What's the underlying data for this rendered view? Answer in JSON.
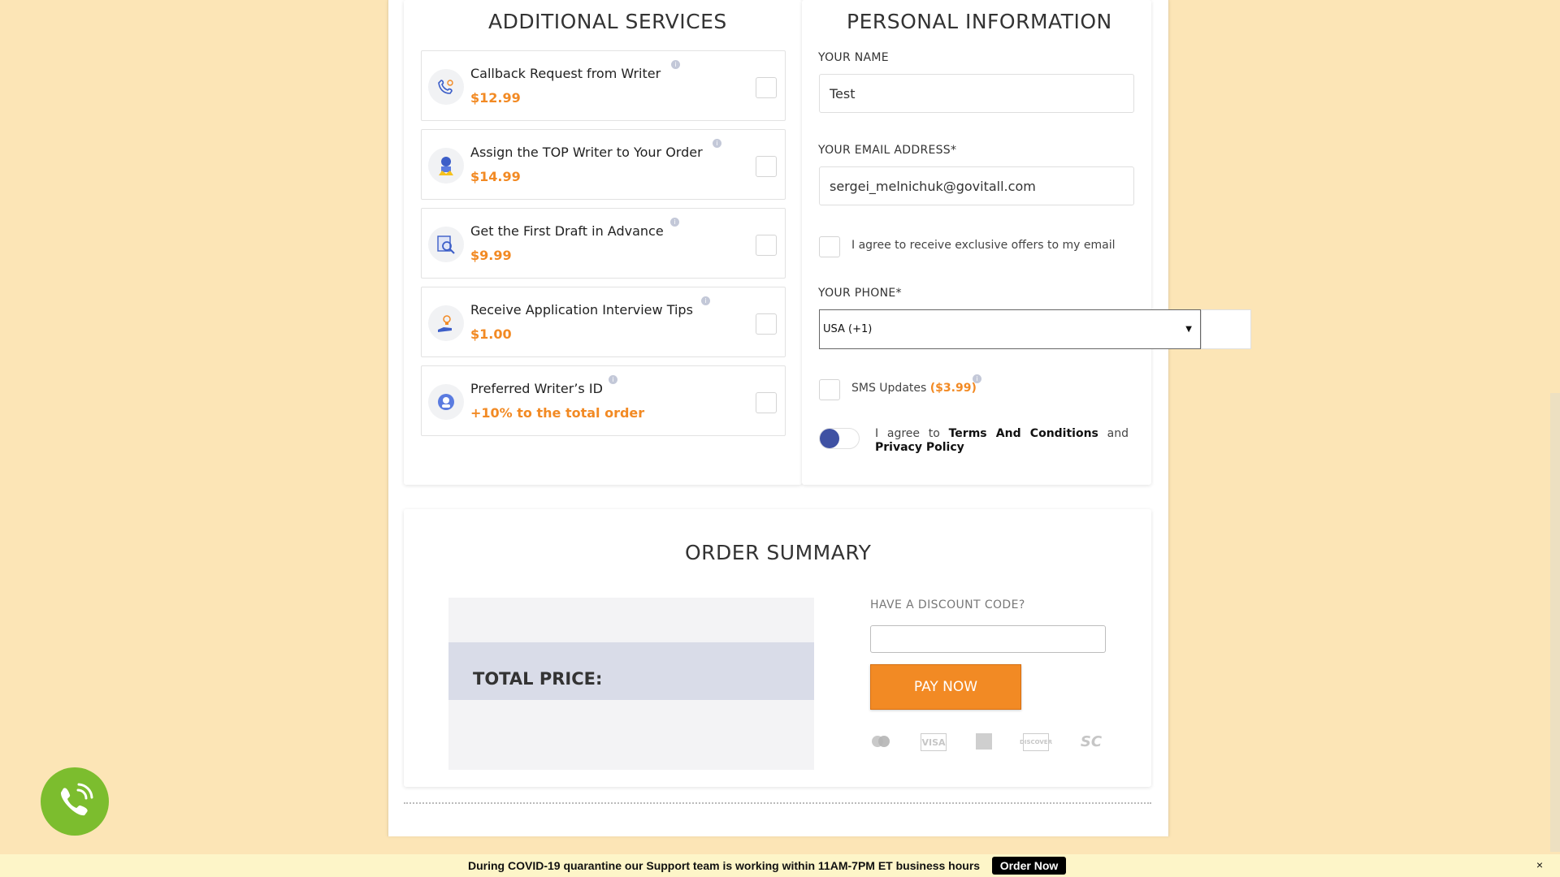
{
  "services": {
    "title": "ADDITIONAL SERVICES",
    "items": [
      {
        "name": "Callback Request from Writer",
        "price": "$12.99",
        "icon": "phone-hand-icon"
      },
      {
        "name": "Assign the TOP Writer to Your Order",
        "price": "$14.99",
        "icon": "top-writer-icon"
      },
      {
        "name": "Get the First Draft in Advance",
        "price": "$9.99",
        "icon": "draft-magnifier-icon"
      },
      {
        "name": "Receive Application Interview Tips",
        "price": "$1.00",
        "icon": "lightbulb-hand-icon"
      },
      {
        "name": "Preferred Writer’s ID",
        "price": "+10% to the total order",
        "icon": "writer-badge-icon"
      }
    ],
    "info_glyph": "i"
  },
  "personal": {
    "title": "PERSONAL INFORMATION",
    "name_label": "YOUR NAME",
    "name_value": "Test",
    "email_label": "YOUR EMAIL ADDRESS*",
    "email_value": "sergei_melnichuk@govitall.com",
    "offers_text": "I agree to receive exclusive offers to my email",
    "phone_label": "YOUR PHONE*",
    "phone_country": "USA (+1)",
    "phone_arrow": "▼",
    "sms_text": "SMS Updates",
    "sms_price": "($3.99)",
    "terms_pre": "I agree to",
    "terms_link": "Terms And Conditions",
    "terms_and": "and",
    "privacy_link": "Privacy Policy"
  },
  "summary": {
    "title": "ORDER SUMMARY",
    "total_label": "TOTAL PRICE:",
    "discount_label": "HAVE A DISCOUNT CODE?",
    "pay_button": "PAY NOW",
    "payment_methods": [
      "mastercard",
      "VISA",
      "amex",
      "DISCOVER",
      "SC"
    ]
  },
  "bottom_bar": {
    "message": "During COVID-19 quarantine our Support team is working within 11AM-7PM ET business hours",
    "order_button": "Order Now",
    "close": "×"
  },
  "colors": {
    "background": "#fce5b6",
    "accent_orange": "#f28a24",
    "call_green": "#7cbd2e",
    "toggle_blue": "#3f51a3"
  }
}
